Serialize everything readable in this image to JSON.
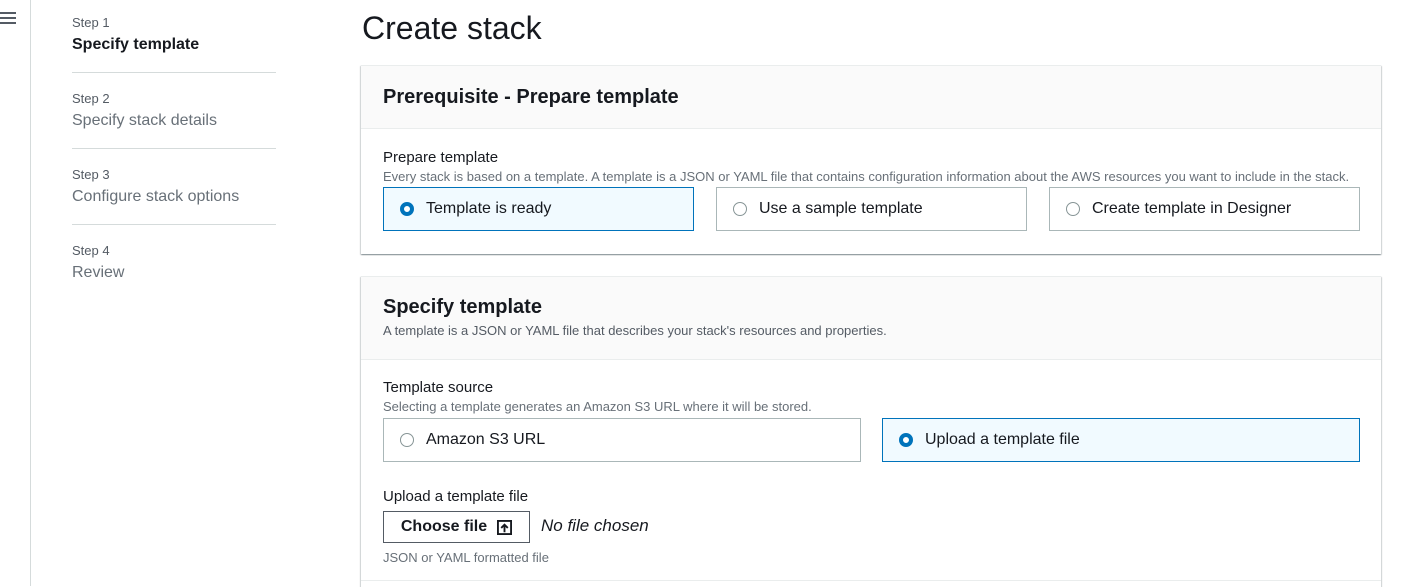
{
  "steps": [
    {
      "number": "Step 1",
      "title": "Specify template"
    },
    {
      "number": "Step 2",
      "title": "Specify stack details"
    },
    {
      "number": "Step 3",
      "title": "Configure stack options"
    },
    {
      "number": "Step 4",
      "title": "Review"
    }
  ],
  "page_title": "Create stack",
  "prerequisite": {
    "heading": "Prerequisite - Prepare template",
    "field_label": "Prepare template",
    "field_desc": "Every stack is based on a template. A template is a JSON or YAML file that contains configuration information about the AWS resources you want to include in the stack.",
    "options": [
      "Template is ready",
      "Use a sample template",
      "Create template in Designer"
    ],
    "selected": "Template is ready"
  },
  "specify": {
    "heading": "Specify template",
    "desc": "A template is a JSON or YAML file that describes your stack's resources and properties.",
    "source_label": "Template source",
    "source_desc": "Selecting a template generates an Amazon S3 URL where it will be stored.",
    "options": [
      "Amazon S3 URL",
      "Upload a template file"
    ],
    "selected": "Upload a template file",
    "upload_label": "Upload a template file",
    "choose_button": "Choose file",
    "no_file": "No file chosen",
    "upload_hint": "JSON or YAML formatted file"
  },
  "colors": {
    "accent": "#0073bb",
    "selected_bg": "#f1faff",
    "text": "#16191f"
  },
  "icons": {
    "menu": "hamburger-menu-icon",
    "upload": "upload-icon"
  }
}
